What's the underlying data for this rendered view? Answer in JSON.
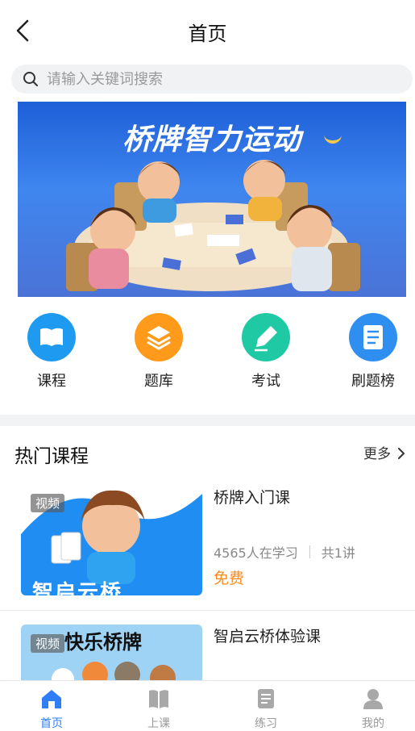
{
  "header": {
    "title": "首页",
    "back_icon": "back-arrow-icon"
  },
  "search": {
    "placeholder": "请输入关键词搜索",
    "value": "",
    "icon": "search-icon"
  },
  "banner": {
    "title": "桥牌智力运动"
  },
  "quick_links": [
    {
      "label": "课程",
      "icon": "book-icon",
      "color": "#1e9bf0"
    },
    {
      "label": "题库",
      "icon": "layers-icon",
      "color": "#ff9a1a"
    },
    {
      "label": "考试",
      "icon": "pen-icon",
      "color": "#1fc9a4"
    },
    {
      "label": "刷题榜",
      "icon": "document-icon",
      "color": "#2f8ff0"
    }
  ],
  "hot_courses": {
    "title": "热门课程",
    "more_label": "更多",
    "items": [
      {
        "title": "桥牌入门课",
        "badge": "视频",
        "thumb_text": "智启云桥",
        "learners": "4565人在学习",
        "lessons": "共1讲",
        "price": "免费"
      },
      {
        "title": "智启云桥体验课",
        "badge": "视频",
        "thumb_text": "快乐桥牌"
      }
    ]
  },
  "tabbar": {
    "tabs": [
      {
        "label": "首页",
        "icon": "home-icon",
        "active": true
      },
      {
        "label": "上课",
        "icon": "open-book-icon",
        "active": false
      },
      {
        "label": "练习",
        "icon": "notes-icon",
        "active": false
      },
      {
        "label": "我的",
        "icon": "user-icon",
        "active": false
      }
    ],
    "active_color": "#2f7ef5",
    "inactive_color": "#999999"
  }
}
